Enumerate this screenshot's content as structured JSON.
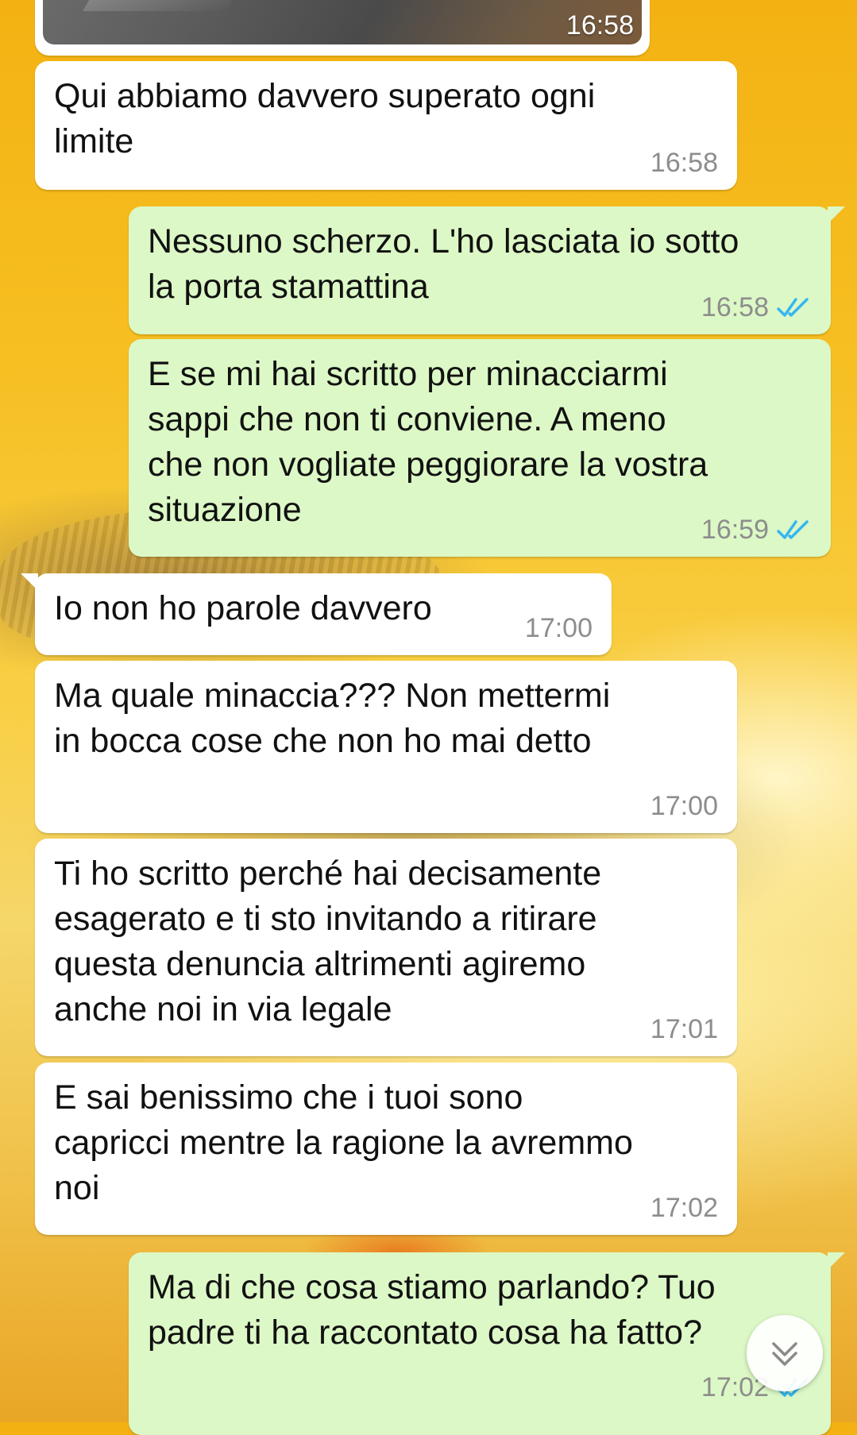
{
  "chat": {
    "media_message": {
      "time": "16:58"
    },
    "messages": [
      {
        "direction": "incoming",
        "text": "Qui abbiamo davvero superato ogni\nlimite",
        "time": "16:58"
      },
      {
        "direction": "outgoing",
        "text": "Nessuno scherzo. L'ho lasciata io sotto\nla porta stamattina",
        "time": "16:58",
        "status": "read"
      },
      {
        "direction": "outgoing",
        "text": "E se mi hai scritto per minacciarmi\nsappi che non ti conviene. A meno\nche non vogliate peggiorare la vostra\nsituazione",
        "time": "16:59",
        "status": "read"
      },
      {
        "direction": "incoming",
        "text": "Io non ho parole davvero",
        "time": "17:00"
      },
      {
        "direction": "incoming",
        "text": "Ma quale minaccia??? Non mettermi\nin bocca cose che non ho mai detto",
        "time": "17:00"
      },
      {
        "direction": "incoming",
        "text": "Ti ho scritto perché hai decisamente\nesagerato e ti sto invitando a ritirare\nquesta denuncia altrimenti agiremo\nanche noi in via legale",
        "time": "17:01"
      },
      {
        "direction": "incoming",
        "text": "E sai benissimo che i tuoi sono\ncapricci mentre la ragione la avremmo\nnoi",
        "time": "17:02"
      },
      {
        "direction": "outgoing",
        "text": "Ma di che cosa stiamo parlando? Tuo\npadre ti ha raccontato cosa ha fatto?",
        "time": "17:02",
        "status": "read"
      }
    ]
  },
  "icons": {
    "read_receipt": "double-check-icon",
    "scroll_down": "chevron-double-down-icon"
  },
  "colors": {
    "incoming_bubble": "#ffffff",
    "outgoing_bubble": "#dcf8c6",
    "read_tick": "#34b7f1",
    "timestamp": "#8d8d8d"
  }
}
